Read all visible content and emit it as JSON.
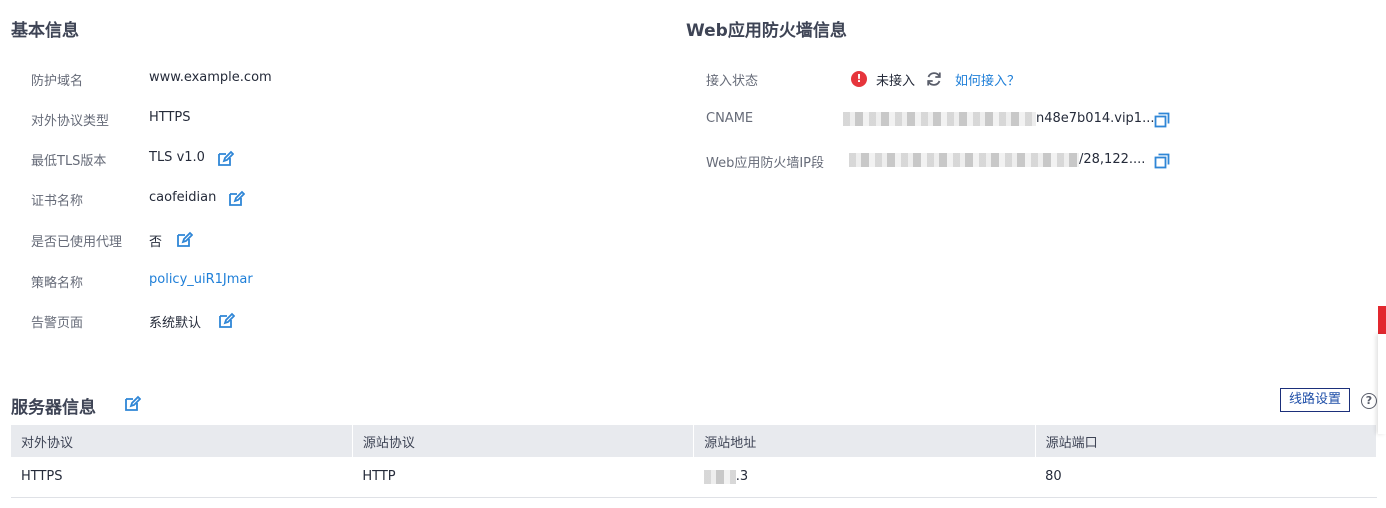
{
  "basic": {
    "title": "基本信息",
    "rows": [
      {
        "label": "防护域名",
        "value": "www.example.com"
      },
      {
        "label": "对外协议类型",
        "value": "HTTPS"
      },
      {
        "label": "最低TLS版本",
        "value": "TLS v1.0"
      },
      {
        "label": "证书名称",
        "value": "caofeidian"
      },
      {
        "label": "是否已使用代理",
        "value": "否"
      },
      {
        "label": "策略名称",
        "value": "policy_uiR1Jmar"
      },
      {
        "label": "告警页面",
        "value": "系统默认"
      }
    ]
  },
  "waf": {
    "title": "Web应用防火墙信息",
    "access_label": "接入状态",
    "access_status": "未接入",
    "access_help": "如何接入？",
    "cname_label": "CNAME",
    "cname_value": "n48e7b014.vip1...",
    "ip_label": "Web应用防火墙IP段",
    "ip_value": "/28,122...."
  },
  "server": {
    "title": "服务器信息",
    "route_button": "线路设置",
    "help_glyph": "?",
    "columns": [
      "对外协议",
      "源站协议",
      "源站地址",
      "源站端口"
    ],
    "rows": [
      {
        "external": "HTTPS",
        "origin_protocol": "HTTP",
        "origin_address": ".3",
        "origin_port": "80"
      }
    ]
  },
  "colors": {
    "link": "#1f7fd8",
    "warning": "#e6353c",
    "edit_icon": "#2f86d6"
  },
  "icons": [
    "edit-icon",
    "copy-icon",
    "warning-icon",
    "refresh-icon",
    "help-icon"
  ]
}
